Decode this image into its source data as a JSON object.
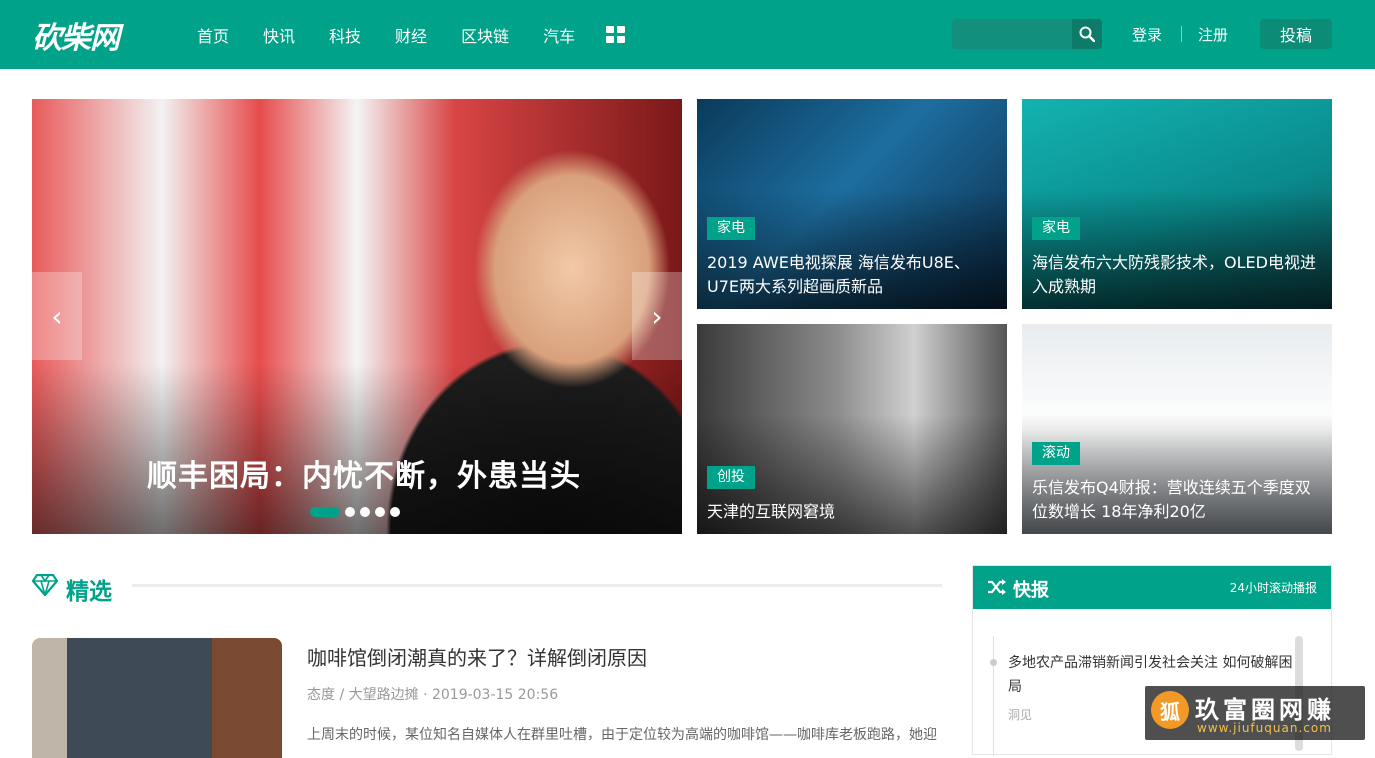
{
  "header": {
    "logo": "砍柴网",
    "nav": [
      "首页",
      "快讯",
      "科技",
      "财经",
      "区块链",
      "汽车"
    ],
    "search_placeholder": "",
    "login": "登录",
    "register": "注册",
    "post": "投稿"
  },
  "slider": {
    "title": "顺丰困局：内忧不断，外患当头",
    "prev": "‹",
    "next": "›"
  },
  "cards": [
    {
      "tag": "家电",
      "title": "2019 AWE电视探展 海信发布U8E、U7E两大系列超画质新品"
    },
    {
      "tag": "家电",
      "title": "海信发布六大防残影技术，OLED电视进入成熟期"
    },
    {
      "tag": "创投",
      "title": "天津的互联网窘境"
    },
    {
      "tag": "滚动",
      "title": "乐信发布Q4财报：营收连续五个季度双位数增长 18年净利20亿"
    }
  ],
  "featured": {
    "section_title": "精选",
    "article": {
      "title": "咖啡馆倒闭潮真的来了？详解倒闭原因",
      "meta": "态度 / 大望路边摊 · 2019-03-15 20:56",
      "excerpt": "上周末的时候，某位知名自媒体人在群里吐槽，由于定位较为高端的咖啡馆——咖啡库老板跑路，她迎"
    }
  },
  "flash": {
    "title": "快报",
    "subtitle": "24小时滚动播报",
    "item_text": "多地农产品滞销新闻引发社会关注 如何破解困局",
    "item_source": "洞见"
  },
  "watermark": {
    "text": "玖富圈网赚",
    "url": "www.jiufuquan.com"
  },
  "colors": {
    "brand": "#00a28a"
  }
}
